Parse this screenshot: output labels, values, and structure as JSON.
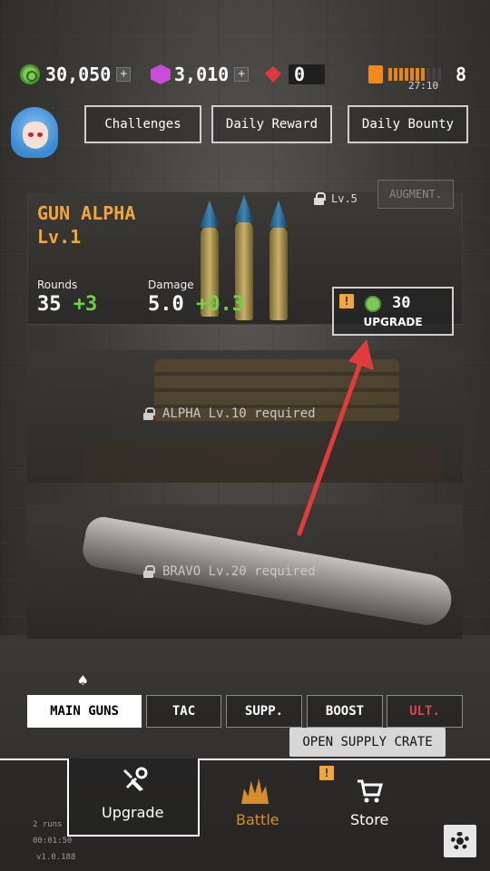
{
  "resources": {
    "coins": "30,050",
    "gems": "3,010",
    "rubies": "0",
    "fuel_count": "8",
    "fuel_timer": "27:10",
    "fuel_level": 0.7,
    "plus_label": "+"
  },
  "header_buttons": {
    "challenges": "Challenges",
    "daily_reward": "Daily Reward",
    "daily_bounty": "Daily Bounty"
  },
  "gun_alpha": {
    "name": "GUN ALPHA",
    "level": "Lv.1",
    "augment_lock_level": "Lv.5",
    "augment_label": "AUGMENT.",
    "rounds_label": "Rounds",
    "rounds_value": "35",
    "rounds_bonus": "+3",
    "damage_label": "Damage",
    "damage_value": "5.0",
    "damage_bonus": "+0.3",
    "upgrade_cost": "30",
    "upgrade_label": "UPGRADE",
    "warning_mark": "!"
  },
  "locked_guns": {
    "alpha_req": "ALPHA Lv.10 required",
    "bravo_req": "BRAVO Lv.20 required"
  },
  "tabs": {
    "main_guns": "MAIN GUNS",
    "tac": "TAC",
    "supp": "SUPP.",
    "boost": "BOOST",
    "ult": "ULT.",
    "spade_mark": "♠"
  },
  "tooltip": "OPEN SUPPLY CRATE",
  "nav": {
    "upgrade": "Upgrade",
    "battle": "Battle",
    "store": "Store",
    "warning_mark": "!"
  },
  "meta": {
    "runs": "2 runs",
    "time": "00:01:50",
    "version": "v1.0.188"
  },
  "colors": {
    "accent_orange": "#f1a53a",
    "bonus_green": "#6fd246",
    "ult_red": "#e04444",
    "arrow_red": "#e23b3b"
  },
  "icons": [
    "coin-icon",
    "gem-icon",
    "ruby-icon",
    "fuel-icon",
    "lock-icon",
    "wrench-icon",
    "battle-icon",
    "cart-icon",
    "gear-icon",
    "warning-icon"
  ]
}
